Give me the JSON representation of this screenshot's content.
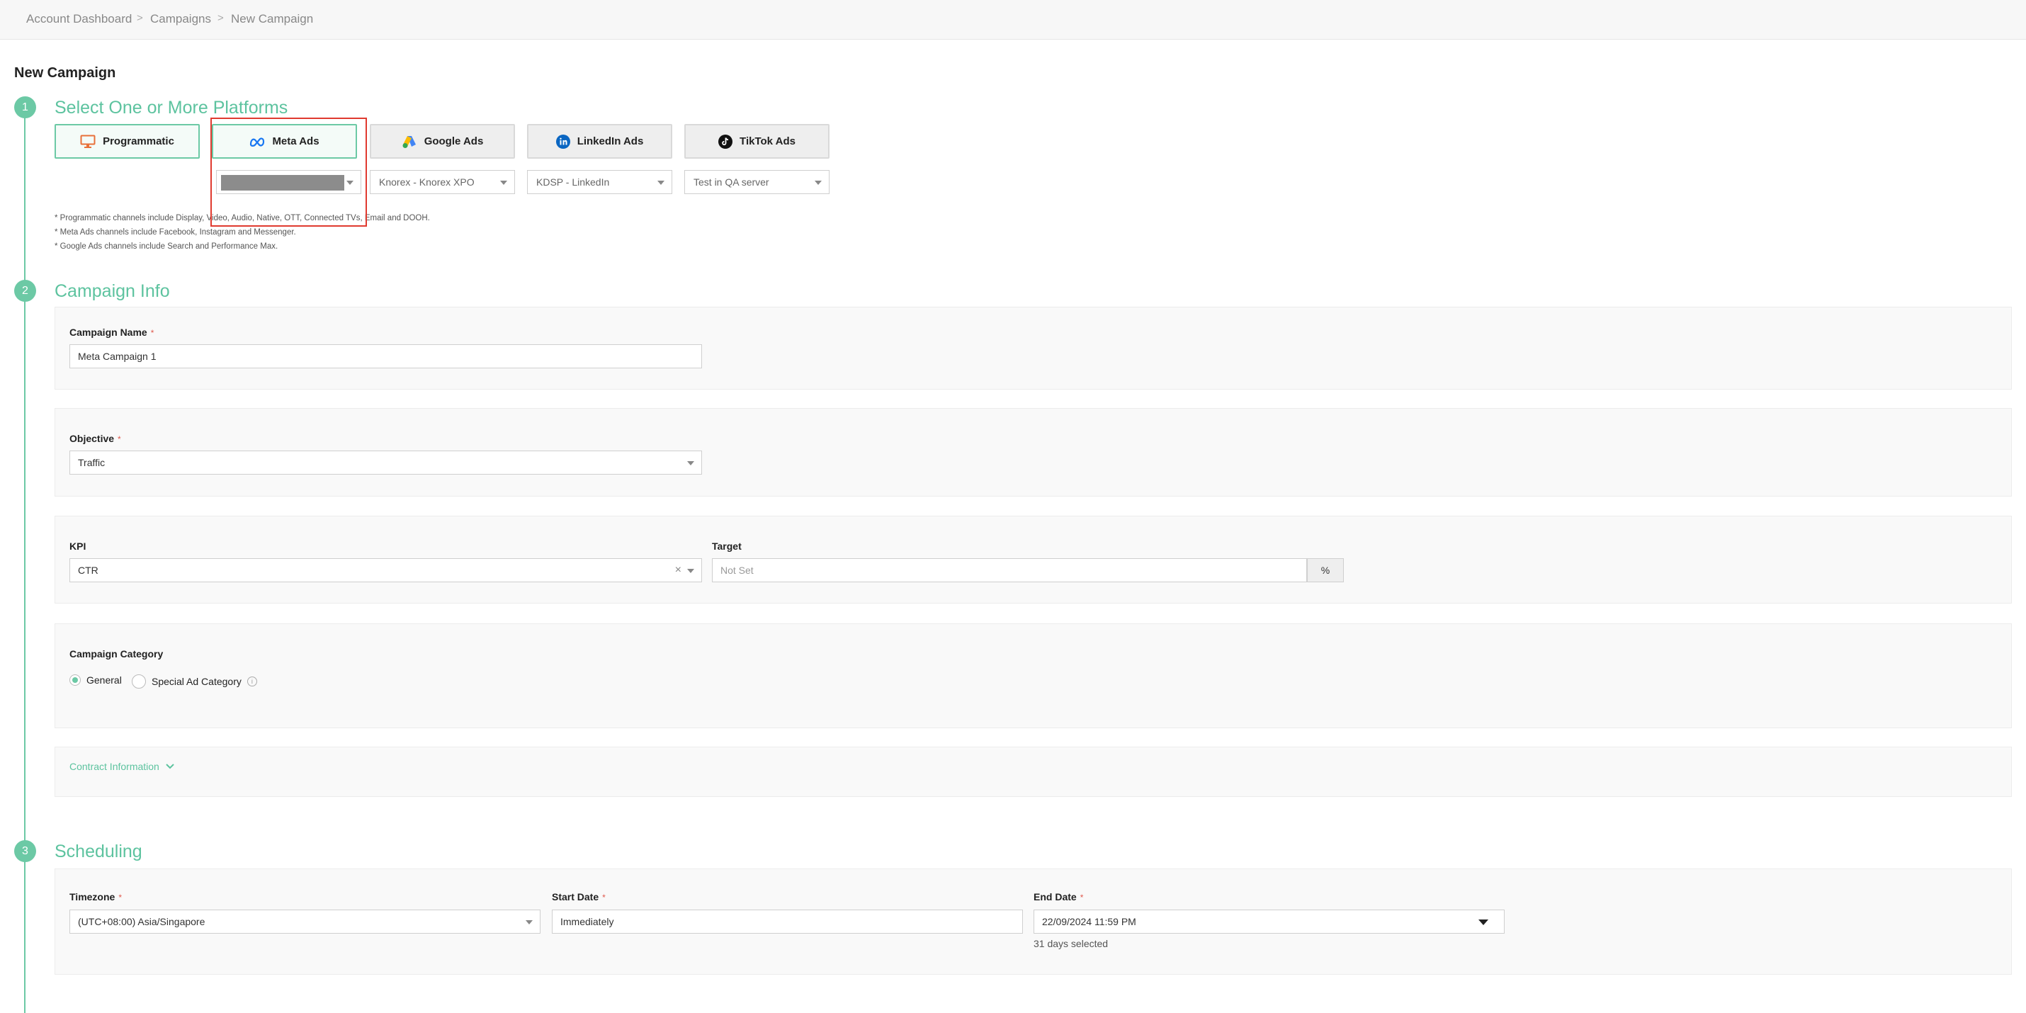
{
  "breadcrumb": [
    "Account Dashboard",
    "Campaigns",
    "New Campaign"
  ],
  "breadcrumb_separator": ">",
  "page_title": "New Campaign",
  "accent_color": "#6cc9a5",
  "steps": [
    {
      "number": "1",
      "title": "Select One or More Platforms"
    },
    {
      "number": "2",
      "title": "Campaign Info"
    },
    {
      "number": "3",
      "title": "Scheduling"
    }
  ],
  "platforms": [
    {
      "label": "Programmatic",
      "icon": "monitor-icon",
      "selected": false,
      "account": ""
    },
    {
      "label": "Meta Ads",
      "icon": "meta-icon",
      "selected": true,
      "account": ""
    },
    {
      "label": "Google Ads",
      "icon": "google-ads-icon",
      "selected": false,
      "account": "Knorex - Knorex XPO"
    },
    {
      "label": "LinkedIn Ads",
      "icon": "linkedin-icon",
      "selected": false,
      "account": "KDSP - LinkedIn"
    },
    {
      "label": "TikTok Ads",
      "icon": "tiktok-icon",
      "selected": false,
      "account": "Test in QA server"
    }
  ],
  "notes": [
    "* Programmatic channels include Display, Video, Audio, Native, OTT, Connected TVs, Email and DOOH.",
    "* Meta Ads channels include Facebook, Instagram and Messenger.",
    "* Google Ads channels include Search and Performance Max."
  ],
  "required_mark": "*",
  "campaign_name": {
    "label": "Campaign Name",
    "value": "Meta Campaign 1"
  },
  "objective": {
    "label": "Objective",
    "value": "Traffic"
  },
  "kpi": {
    "label": "KPI",
    "value": "CTR",
    "clear": "×"
  },
  "target": {
    "label": "Target",
    "placeholder": "Not Set",
    "unit": "%"
  },
  "campaign_category": {
    "label": "Campaign Category",
    "options": [
      "General",
      "Special Ad Category"
    ],
    "selected": "General"
  },
  "contract_info": {
    "label": "Contract Information"
  },
  "scheduling": {
    "timezone": {
      "label": "Timezone",
      "value": "(UTC+08:00) Asia/Singapore"
    },
    "start_date": {
      "label": "Start Date",
      "value": "Immediately"
    },
    "end_date": {
      "label": "End Date",
      "value": "22/09/2024 11:59 PM"
    },
    "days_selected": "31 days selected"
  }
}
